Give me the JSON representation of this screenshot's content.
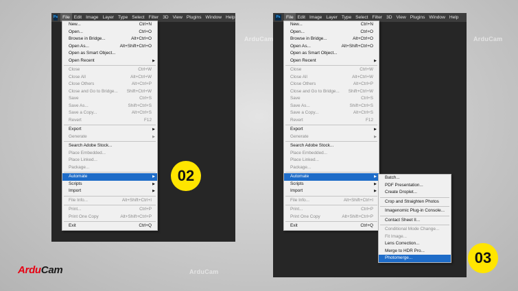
{
  "brand": {
    "part1": "Ardu",
    "part2": "Cam"
  },
  "watermark": "ArduCam",
  "menubar": [
    "File",
    "Edit",
    "Image",
    "Layer",
    "Type",
    "Select",
    "Filter",
    "3D",
    "View",
    "Plugins",
    "Window",
    "Help"
  ],
  "ps_logo": "Ps",
  "file_menu": [
    {
      "label": "New...",
      "shortcut": "Ctrl+N",
      "state": "enabled"
    },
    {
      "label": "Open...",
      "shortcut": "Ctrl+O",
      "state": "enabled"
    },
    {
      "label": "Browse in Bridge...",
      "shortcut": "Alt+Ctrl+O",
      "state": "enabled"
    },
    {
      "label": "Open As...",
      "shortcut": "Alt+Shift+Ctrl+O",
      "state": "enabled"
    },
    {
      "label": "Open as Smart Object...",
      "shortcut": "",
      "state": "enabled"
    },
    {
      "label": "Open Recent",
      "shortcut": "",
      "state": "enabled",
      "submenu": true
    },
    {
      "sep": true
    },
    {
      "label": "Close",
      "shortcut": "Ctrl+W",
      "state": "disabled"
    },
    {
      "label": "Close All",
      "shortcut": "Alt+Ctrl+W",
      "state": "disabled"
    },
    {
      "label": "Close Others",
      "shortcut": "Alt+Ctrl+P",
      "state": "disabled"
    },
    {
      "label": "Close and Go to Bridge...",
      "shortcut": "Shift+Ctrl+W",
      "state": "disabled"
    },
    {
      "label": "Save",
      "shortcut": "Ctrl+S",
      "state": "disabled"
    },
    {
      "label": "Save As...",
      "shortcut": "Shift+Ctrl+S",
      "state": "disabled"
    },
    {
      "label": "Save a Copy...",
      "shortcut": "Alt+Ctrl+S",
      "state": "disabled"
    },
    {
      "label": "Revert",
      "shortcut": "F12",
      "state": "disabled"
    },
    {
      "sep": true
    },
    {
      "label": "Export",
      "shortcut": "",
      "state": "enabled",
      "submenu": true
    },
    {
      "label": "Generate",
      "shortcut": "",
      "state": "disabled",
      "submenu": true
    },
    {
      "sep": true
    },
    {
      "label": "Search Adobe Stock...",
      "shortcut": "",
      "state": "enabled"
    },
    {
      "label": "Place Embedded...",
      "shortcut": "",
      "state": "disabled"
    },
    {
      "label": "Place Linked...",
      "shortcut": "",
      "state": "disabled"
    },
    {
      "label": "Package...",
      "shortcut": "",
      "state": "disabled"
    },
    {
      "sep": true
    },
    {
      "label": "Automate",
      "shortcut": "",
      "state": "highlight",
      "submenu": true
    },
    {
      "label": "Scripts",
      "shortcut": "",
      "state": "enabled",
      "submenu": true
    },
    {
      "label": "Import",
      "shortcut": "",
      "state": "enabled",
      "submenu": true
    },
    {
      "sep": true
    },
    {
      "label": "File Info...",
      "shortcut": "Alt+Shift+Ctrl+I",
      "state": "disabled"
    },
    {
      "sep": true
    },
    {
      "label": "Print...",
      "shortcut": "Ctrl+P",
      "state": "disabled"
    },
    {
      "label": "Print One Copy",
      "shortcut": "Alt+Shift+Ctrl+P",
      "state": "disabled"
    },
    {
      "sep": true
    },
    {
      "label": "Exit",
      "shortcut": "Ctrl+Q",
      "state": "enabled"
    }
  ],
  "automate_submenu": [
    {
      "label": "Batch...",
      "state": "enabled"
    },
    {
      "label": "PDF Presentation...",
      "state": "enabled"
    },
    {
      "label": "Create Droplet...",
      "state": "enabled"
    },
    {
      "sep": true
    },
    {
      "label": "Crop and Straighten Photos",
      "state": "enabled"
    },
    {
      "sep": true
    },
    {
      "label": "Imagenomic Plug-in Console...",
      "state": "enabled"
    },
    {
      "sep": true
    },
    {
      "label": "Contact Sheet II...",
      "state": "enabled"
    },
    {
      "sep": true
    },
    {
      "label": "Conditional Mode Change...",
      "state": "disabled"
    },
    {
      "label": "Fit Image...",
      "state": "disabled"
    },
    {
      "label": "Lens Correction...",
      "state": "enabled"
    },
    {
      "label": "Merge to HDR Pro...",
      "state": "enabled"
    },
    {
      "label": "Photomerge...",
      "state": "highlight"
    }
  ],
  "steps": [
    "02",
    "03"
  ],
  "colors": {
    "badge": "#ffe500",
    "highlight": "#1e6cc8",
    "brand_red": "#e60012"
  }
}
